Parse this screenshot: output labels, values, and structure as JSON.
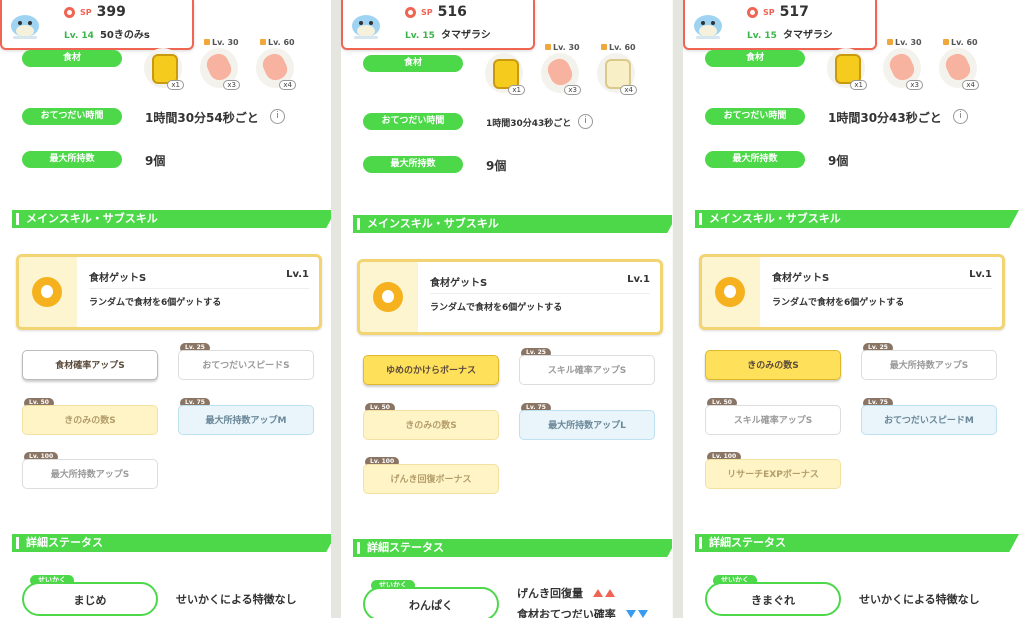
{
  "panels": [
    {
      "sp_label": "SP",
      "sp": "399",
      "level": "Lv. 14",
      "nickname": "50きのみs",
      "ingredient_label": "食材",
      "ingredients": [
        {
          "lv": "",
          "qty": "x1",
          "type": "honey"
        },
        {
          "lv": "Lv. 30",
          "qty": "x3",
          "type": "meat"
        },
        {
          "lv": "Lv. 60",
          "qty": "x4",
          "type": "meat"
        }
      ],
      "help_label": "おてつだい時間",
      "help_time": "1時間30分54秒ごと",
      "max_label": "最大所持数",
      "max_value": "9個",
      "skills_title": "メインスキル・サブスキル",
      "main_skill": {
        "name": "食材ゲットS",
        "level": "Lv.1",
        "desc": "ランダムで食材を6個ゲットする"
      },
      "sub_skills": [
        {
          "label": "食材確率アップS",
          "lock": "",
          "style": "active-w"
        },
        {
          "label": "おてつだいスピードS",
          "lock": "Lv. 25",
          "style": "locked-w"
        },
        {
          "label": "きのみの数S",
          "lock": "Lv. 50",
          "style": "locked-y"
        },
        {
          "label": "最大所持数アップM",
          "lock": "Lv. 75",
          "style": "locked-b"
        },
        {
          "label": "最大所持数アップS",
          "lock": "Lv. 100",
          "style": "locked-w"
        }
      ],
      "status_title": "詳細ステータス",
      "nature_tag": "せいかく",
      "nature": "まじめ",
      "nature_effect": "せいかくによる特徴なし"
    },
    {
      "sp_label": "SP",
      "sp": "516",
      "level": "Lv. 15",
      "nickname": "タマザラシ",
      "ingredient_label": "食材",
      "ingredients": [
        {
          "lv": "",
          "qty": "x1",
          "type": "honey"
        },
        {
          "lv": "Lv. 30",
          "qty": "x3",
          "type": "meat"
        },
        {
          "lv": "Lv. 60",
          "qty": "x4",
          "type": "milk"
        }
      ],
      "help_label": "おてつだい時間",
      "help_time": "1時間30分43秒ごと",
      "max_label": "最大所持数",
      "max_value": "9個",
      "skills_title": "メインスキル・サブスキル",
      "main_skill": {
        "name": "食材ゲットS",
        "level": "Lv.1",
        "desc": "ランダムで食材を6個ゲットする"
      },
      "sub_skills": [
        {
          "label": "ゆめのかけらボーナス",
          "lock": "",
          "style": "active-y"
        },
        {
          "label": "スキル確率アップS",
          "lock": "Lv. 25",
          "style": "locked-w"
        },
        {
          "label": "きのみの数S",
          "lock": "Lv. 50",
          "style": "locked-y"
        },
        {
          "label": "最大所持数アップL",
          "lock": "Lv. 75",
          "style": "locked-b"
        },
        {
          "label": "げんき回復ボーナス",
          "lock": "Lv. 100",
          "style": "locked-y"
        }
      ],
      "status_title": "詳細ステータス",
      "nature_tag": "せいかく",
      "nature": "わんぱく",
      "nature_up": "げんき回復量",
      "nature_down": "食材おてつだい確率"
    },
    {
      "sp_label": "SP",
      "sp": "517",
      "level": "Lv. 15",
      "nickname": "タマザラシ",
      "ingredient_label": "食材",
      "ingredients": [
        {
          "lv": "",
          "qty": "x1",
          "type": "honey"
        },
        {
          "lv": "Lv. 30",
          "qty": "x3",
          "type": "meat"
        },
        {
          "lv": "Lv. 60",
          "qty": "x4",
          "type": "meat"
        }
      ],
      "help_label": "おてつだい時間",
      "help_time": "1時間30分43秒ごと",
      "max_label": "最大所持数",
      "max_value": "9個",
      "skills_title": "メインスキル・サブスキル",
      "main_skill": {
        "name": "食材ゲットS",
        "level": "Lv.1",
        "desc": "ランダムで食材を6個ゲットする"
      },
      "sub_skills": [
        {
          "label": "きのみの数S",
          "lock": "",
          "style": "active-y"
        },
        {
          "label": "最大所持数アップS",
          "lock": "Lv. 25",
          "style": "locked-w"
        },
        {
          "label": "スキル確率アップS",
          "lock": "Lv. 50",
          "style": "locked-w"
        },
        {
          "label": "おてつだいスピードM",
          "lock": "Lv. 75",
          "style": "locked-b"
        },
        {
          "label": "リサーチEXPボーナス",
          "lock": "Lv. 100",
          "style": "locked-y"
        }
      ],
      "status_title": "詳細ステータス",
      "nature_tag": "せいかく",
      "nature": "きまぐれ",
      "nature_effect": "せいかくによる特徴なし"
    }
  ],
  "colors": {
    "accent_green": "#4dd84a",
    "header_red": "#f06454",
    "skill_gold": "#f5b21e"
  }
}
